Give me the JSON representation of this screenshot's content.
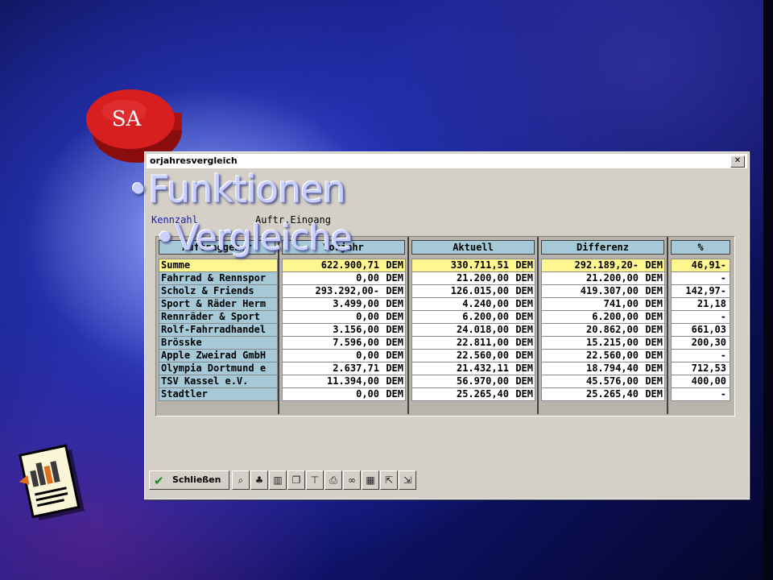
{
  "badge": {
    "text": "SA",
    "color": "#d81e1e"
  },
  "window": {
    "title": "orjahresvergleich",
    "close_glyph": "✕",
    "kennzahl_label": "Kennzahl",
    "kennzahl_value": "Auftr.Eingang"
  },
  "bullets": [
    "•Funktionen",
    "•Vergleiche"
  ],
  "table": {
    "columns": {
      "name": "Auftraggeber",
      "vorjahr": "Vorjahr",
      "aktuell": "Aktuell",
      "differenz": "Differenz",
      "percent": "%"
    },
    "currency": "DEM",
    "rows": [
      {
        "name": "Summe",
        "vorjahr": "622.900,71",
        "aktuell": "330.711,51",
        "differenz": "292.189,20-",
        "percent": "46,91-",
        "highlight": true
      },
      {
        "name": "Fahrrad & Rennspor",
        "vorjahr": "0,00",
        "aktuell": "21.200,00",
        "differenz": "21.200,00",
        "percent": "-"
      },
      {
        "name": "Scholz & Friends",
        "vorjahr": "293.292,00-",
        "aktuell": "126.015,00",
        "differenz": "419.307,00",
        "percent": "142,97-"
      },
      {
        "name": "Sport & Räder Herm",
        "vorjahr": "3.499,00",
        "aktuell": "4.240,00",
        "differenz": "741,00",
        "percent": "21,18"
      },
      {
        "name": "Rennräder & Sport",
        "vorjahr": "0,00",
        "aktuell": "6.200,00",
        "differenz": "6.200,00",
        "percent": "-"
      },
      {
        "name": "Rolf-Fahrradhandel",
        "vorjahr": "3.156,00",
        "aktuell": "24.018,00",
        "differenz": "20.862,00",
        "percent": "661,03"
      },
      {
        "name": "Brösske",
        "vorjahr": "7.596,00",
        "aktuell": "22.811,00",
        "differenz": "15.215,00",
        "percent": "200,30"
      },
      {
        "name": "Apple Zweirad GmbH",
        "vorjahr": "0,00",
        "aktuell": "22.560,00",
        "differenz": "22.560,00",
        "percent": "-"
      },
      {
        "name": "Olympia Dortmund e",
        "vorjahr": "2.637,71",
        "aktuell": "21.432,11",
        "differenz": "18.794,40",
        "percent": "712,53"
      },
      {
        "name": "TSV Kassel e.V.",
        "vorjahr": "11.394,00",
        "aktuell": "56.970,00",
        "differenz": "45.576,00",
        "percent": "400,00"
      },
      {
        "name": "Stadtler",
        "vorjahr": "0,00",
        "aktuell": "25.265,40",
        "differenz": "25.265,40",
        "percent": "-"
      }
    ]
  },
  "toolbar": {
    "close_label": "Schließen",
    "close_icon": "check-icon",
    "buttons": [
      "search-icon",
      "hierarchy-icon",
      "chart-icon",
      "copy-icon",
      "filter-icon",
      "print-icon",
      "binoculars-icon",
      "calendar-icon",
      "export-icon",
      "import-icon"
    ]
  },
  "colors": {
    "highlight_row": "#fff690",
    "header_cell": "#a6c9d8",
    "window_bg": "#d4d0c8"
  }
}
